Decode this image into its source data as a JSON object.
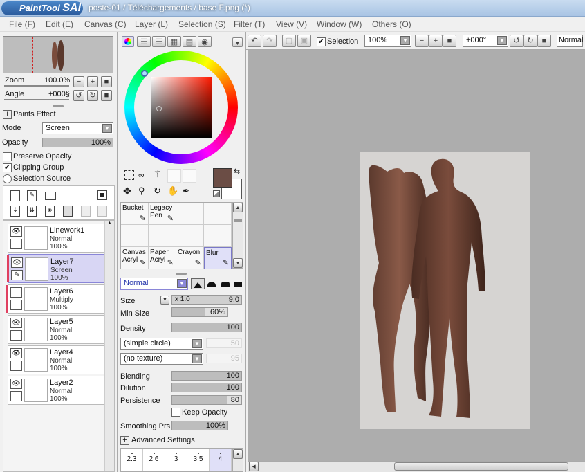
{
  "window": {
    "app_name": "PaintTool SAI",
    "title": "poste-01 / Téléchargements / base F.png (*)"
  },
  "menu": [
    "File (F)",
    "Edit (E)",
    "Canvas (C)",
    "Layer (L)",
    "Selection (S)",
    "Filter (T)",
    "View (V)",
    "Window (W)",
    "Others (O)"
  ],
  "navigator": {
    "zoom_label": "Zoom",
    "zoom_value": "100.0%",
    "angle_label": "Angle",
    "angle_value": "+000§"
  },
  "layer_props": {
    "paints_effect": "Paints Effect",
    "mode_label": "Mode",
    "mode_value": "Screen",
    "opacity_label": "Opacity",
    "opacity_value": "100%",
    "preserve_opacity": "Preserve Opacity",
    "clipping_group": "Clipping Group",
    "selection_source": "Selection Source",
    "preserve_checked": false,
    "clipping_checked": true
  },
  "layers": [
    {
      "name": "Linework1",
      "mode": "Normal",
      "opacity": "100%",
      "visible": true,
      "selected": false,
      "clip": false
    },
    {
      "name": "Layer7",
      "mode": "Screen",
      "opacity": "100%",
      "visible": true,
      "selected": true,
      "clip": true
    },
    {
      "name": "Layer6",
      "mode": "Multiply",
      "opacity": "100%",
      "visible": false,
      "selected": false,
      "clip": true
    },
    {
      "name": "Layer5",
      "mode": "Normal",
      "opacity": "100%",
      "visible": true,
      "selected": false,
      "clip": false
    },
    {
      "name": "Layer4",
      "mode": "Normal",
      "opacity": "100%",
      "visible": true,
      "selected": false,
      "clip": false
    },
    {
      "name": "Layer2",
      "mode": "Normal",
      "opacity": "100%",
      "visible": true,
      "selected": false,
      "clip": false
    }
  ],
  "colors": {
    "primary": "#6b4d45",
    "secondary": "#ffffff",
    "selection_accent": "#8a86d8"
  },
  "tools": [
    {
      "label": "Bucket",
      "icon": "bucket-icon",
      "active": false
    },
    {
      "label": "Legacy Pen",
      "icon": "pen-icon",
      "active": false
    },
    {
      "label": "",
      "icon": "",
      "active": false
    },
    {
      "label": "",
      "icon": "",
      "active": false
    },
    {
      "label": "",
      "icon": "",
      "active": false
    },
    {
      "label": "",
      "icon": "",
      "active": false
    },
    {
      "label": "",
      "icon": "",
      "active": false
    },
    {
      "label": "",
      "icon": "",
      "active": false
    },
    {
      "label": "Canvas Acryl",
      "icon": "brush-icon",
      "active": false
    },
    {
      "label": "Paper Acryl",
      "icon": "brush-icon",
      "active": false
    },
    {
      "label": "Crayon",
      "icon": "crayon-icon",
      "active": false
    },
    {
      "label": "Blur",
      "icon": "blur-icon",
      "active": true
    }
  ],
  "brush": {
    "blend_mode": "Normal",
    "size_label": "Size",
    "size_mult": "x 1.0",
    "size_value": "9.0",
    "min_size_label": "Min Size",
    "min_size_value": "60%",
    "min_size_fraction": 0.6,
    "density_label": "Density",
    "density_value": "100",
    "shape": "(simple circle)",
    "shape_value": "50",
    "texture": "(no texture)",
    "texture_value": "95",
    "blending_label": "Blending",
    "blending_value": "100",
    "dilution_label": "Dilution",
    "dilution_value": "100",
    "persistence_label": "Persistence",
    "persistence_value": "80",
    "persistence_fraction": 0.8,
    "keep_opacity": "Keep Opacity",
    "smoothing_label": "Smoothing Prs",
    "smoothing_value": "100%",
    "advanced": "Advanced Settings",
    "preset_sizes": [
      "2.3",
      "2.6",
      "3",
      "3.5",
      "4"
    ]
  },
  "canvas_toolbar": {
    "selection_label": "Selection",
    "selection_checked": true,
    "zoom": "100%",
    "angle": "+000°",
    "mode": "Normal"
  }
}
